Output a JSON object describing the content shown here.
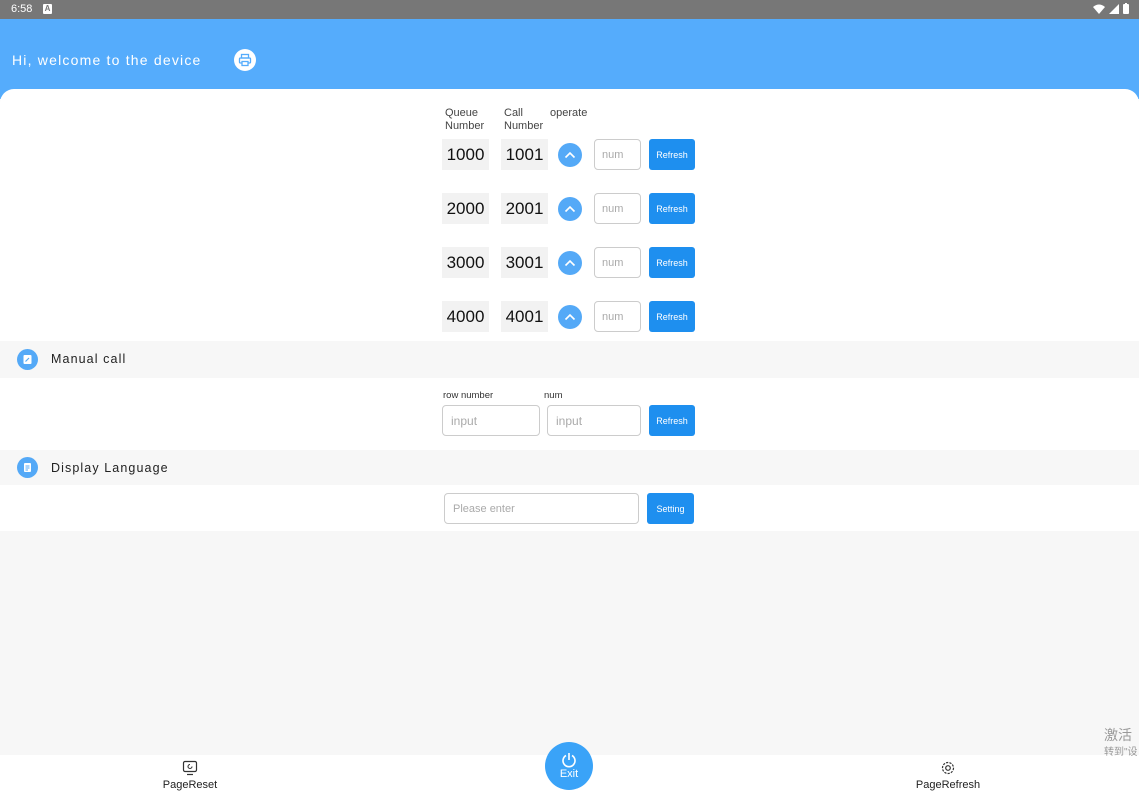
{
  "status": {
    "time": "6:58",
    "notif_badge": "A"
  },
  "header": {
    "greeting": "Hi, welcome to the device",
    "print_icon": "printer-icon"
  },
  "queue_table": {
    "headers": {
      "queue": "Queue Number",
      "call": "Call Number",
      "operate": "operate"
    },
    "rows": [
      {
        "queue": "1000",
        "call": "1001",
        "input_placeholder": "num",
        "button": "Refresh"
      },
      {
        "queue": "2000",
        "call": "2001",
        "input_placeholder": "num",
        "button": "Refresh"
      },
      {
        "queue": "3000",
        "call": "3001",
        "input_placeholder": "num",
        "button": "Refresh"
      },
      {
        "queue": "4000",
        "call": "4001",
        "input_placeholder": "num",
        "button": "Refresh"
      }
    ]
  },
  "manual_call": {
    "title": "Manual call",
    "row_label": "row number",
    "num_label": "num",
    "row_placeholder": "input",
    "num_placeholder": "input",
    "button": "Refresh"
  },
  "display_language": {
    "title": "Display Language",
    "placeholder": "Please enter",
    "button": "Setting"
  },
  "bottom_nav": {
    "left": "PageReset",
    "center": "Exit",
    "right": "PageRefresh"
  },
  "watermark": {
    "line1": "激活",
    "line2": "转到\"设"
  },
  "colors": {
    "header": "#55acfc",
    "accent": "#1e8fef",
    "icon": "#54a9f7"
  }
}
